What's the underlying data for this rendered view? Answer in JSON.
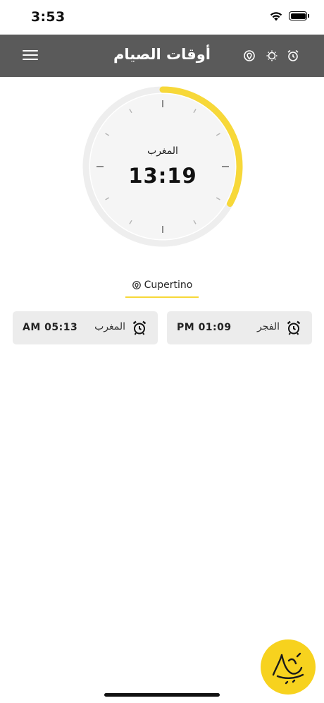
{
  "status_bar": {
    "time": "3:53"
  },
  "header": {
    "title": "أوقات الصيام",
    "icons": [
      "menu-icon",
      "location-pin-icon",
      "sun-icon",
      "alarm-clock-icon"
    ]
  },
  "dial": {
    "prayer_label": "المغرب",
    "countdown": "13:19",
    "progress_fraction": 0.33,
    "accent_color": "#f7d839",
    "track_color": "#eeeeee"
  },
  "location": {
    "city": "Cupertino"
  },
  "cards": [
    {
      "label": "الفجر",
      "time": "PM 01:09",
      "icon": "alarm-clock-icon"
    },
    {
      "label": "المغرب",
      "time": "AM 05:13",
      "icon": "alarm-clock-icon"
    }
  ],
  "colors": {
    "header_bg": "#5a5a5a",
    "accent": "#f7d839",
    "card_bg": "#ececec",
    "logo_bg": "#f7d21e"
  }
}
